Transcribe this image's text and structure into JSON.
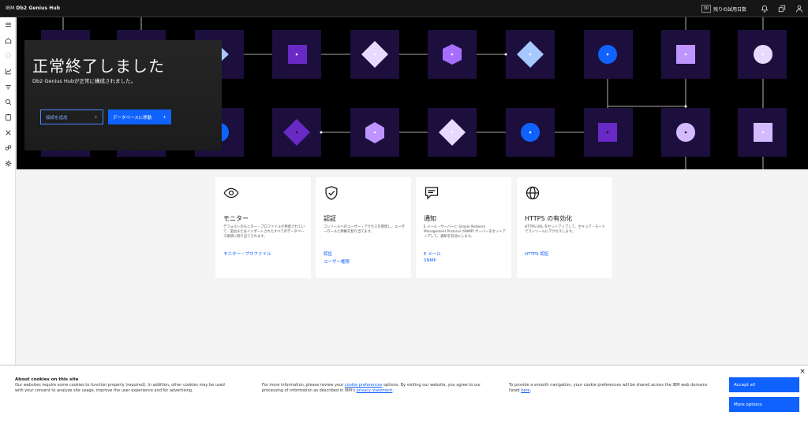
{
  "header": {
    "brand_prefix": "IBM",
    "brand_name": "Db2 Genius Hub",
    "trial_days": "30",
    "trial_label": "残りの試用日数"
  },
  "icons": {
    "top": [
      "bell-icon",
      "switcher-icon",
      "user-icon"
    ],
    "rail": [
      "menu-icon",
      "home-icon",
      "settings-disabled-icon",
      "chart-icon",
      "recommend-icon",
      "search-query-icon",
      "clipboard-icon",
      "flow-icon",
      "tune-icon",
      "gear-icon"
    ]
  },
  "hero": {
    "title": "正常終了しました",
    "subtitle": "Db2 Genius Hubが正常に構成されました。",
    "add_connection": "接続を追加",
    "go_database": "データベースに移動"
  },
  "cards": [
    {
      "title": "モニター",
      "icon": "eye-icon",
      "desc": "デフォルトのモニター・プロファイルが用意されていて、追加またはインポートされたすべてのデータベース接続に割り当てられます。",
      "links": [
        "モニター・プロファイル"
      ]
    },
    {
      "title": "認証",
      "icon": "shield-check-icon",
      "desc": "コンソールへのユーザー・アクセスを管理し、ユーザーロールと特権を割り当てます。",
      "links": [
        "認証",
        "ユーザー権限"
      ]
    },
    {
      "title": "通知",
      "icon": "chat-icon",
      "desc": "E メール・サーバーと Simple Network Management Protocol (SNMP) サーバーをセットアップして、通知を有効にします。",
      "links": [
        "E メール",
        "SNMP"
      ]
    },
    {
      "title": "HTTPS の有効化",
      "icon": "globe-icon",
      "desc": "HTTPS URL をセットアップして、セキュア・モードでコンソールにアクセスします。",
      "links": [
        "HTTPS 認証"
      ]
    }
  ],
  "cookie": {
    "heading": "About cookies on this site",
    "text1": "Our websites require some cookies to function properly (required). In addition, other cookies may be used with your consent to analyze site usage, improve the user experience and for advertising.",
    "text2_a": "For more information, please review your ",
    "text2_link1": "cookie preferences",
    "text2_b": " options. By visiting our website, you agree to our processing of information as described in IBM's ",
    "text2_link2": "privacy statement",
    "text2_c": ".",
    "text3_a": "To provide a smooth navigation, your cookie preferences will be shared across the IBM web domains listed ",
    "text3_link": "here",
    "text3_b": ".",
    "accept": "Accept all",
    "more": "More options",
    "close": "×"
  },
  "colors": {
    "accent": "#0f62fe",
    "hero_bg": "#000000",
    "tile": "#1c0f3d",
    "purple": "#6929c4",
    "lavender": "#a56eff",
    "light_lavender": "#d4bbff",
    "blue": "#0f62fe",
    "light_blue": "#a6c8ff"
  }
}
